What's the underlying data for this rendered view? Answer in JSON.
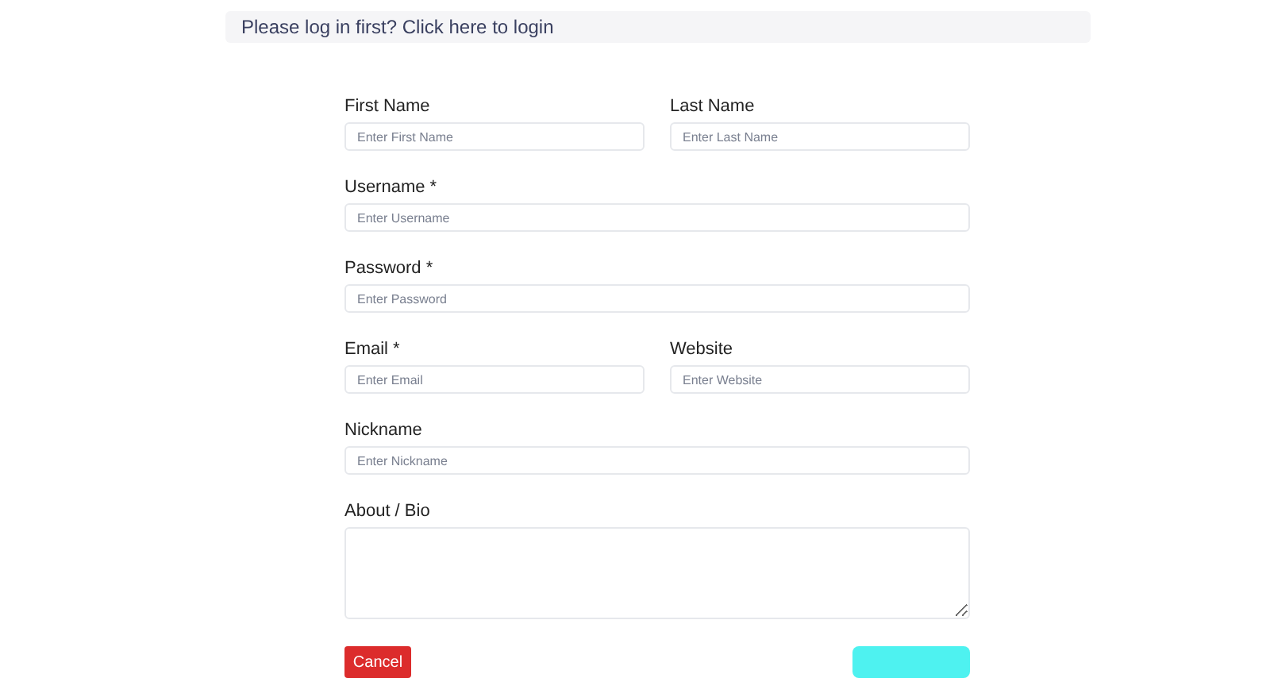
{
  "notice": {
    "text": "Please log in first? Click here to login"
  },
  "rows": [
    {
      "fields": [
        {
          "label": "First Name",
          "placeholder": "Enter First Name"
        },
        {
          "label": "Last Name",
          "placeholder": "Enter Last Name"
        }
      ]
    },
    {
      "fields": [
        {
          "label": "Username *",
          "placeholder": "Enter Username"
        }
      ]
    },
    {
      "fields": [
        {
          "label": "Password *",
          "placeholder": "Enter Password"
        }
      ]
    },
    {
      "fields": [
        {
          "label": "Email *",
          "placeholder": "Enter Email"
        },
        {
          "label": "Website",
          "placeholder": "Enter Website"
        }
      ]
    },
    {
      "fields": [
        {
          "label": "Nickname",
          "placeholder": "Enter Nickname"
        }
      ]
    }
  ],
  "bio": {
    "label": "About / Bio"
  },
  "cancel_button": {
    "label": "Cancel"
  }
}
